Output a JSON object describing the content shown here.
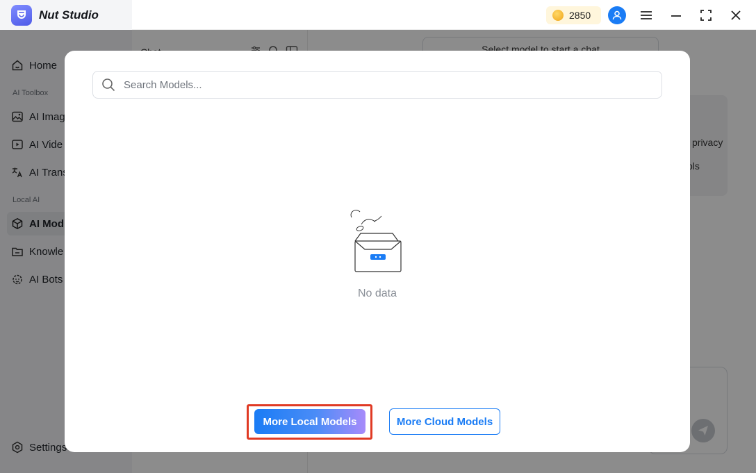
{
  "app": {
    "name": "Nut Studio"
  },
  "header": {
    "coins": "2850"
  },
  "sidebar": {
    "home": "Home",
    "section_toolbox": "AI Toolbox",
    "items_toolbox": [
      "AI Imag",
      "AI Vide",
      "AI Trans"
    ],
    "section_local": "Local AI",
    "items_local": [
      "AI Mod",
      "Knowle",
      "AI Bots"
    ],
    "settings": "Settings"
  },
  "chat_panel": {
    "title": "Chat"
  },
  "main": {
    "select_model": "Select model to start a chat",
    "info_lines": [
      "privacy",
      "ols"
    ]
  },
  "modal": {
    "search_placeholder": "Search Models...",
    "empty_text": "No data",
    "local_button": "More Local Models",
    "cloud_button": "More Cloud Models"
  },
  "colors": {
    "accent": "#1a7cf5",
    "highlight": "#e03a24",
    "coin_bg": "#fff6dc"
  }
}
